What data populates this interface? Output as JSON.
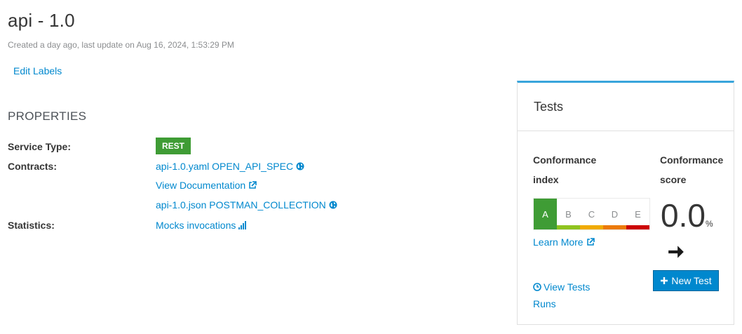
{
  "header": {
    "title": "api - 1.0",
    "subtitle": "Created a day ago, last update on Aug 16, 2024, 1:53:29 PM",
    "edit_labels": "Edit Labels"
  },
  "properties": {
    "heading": "PROPERTIES",
    "service_type_label": "Service Type:",
    "service_type_value": "REST",
    "contracts_label": "Contracts:",
    "contracts": [
      {
        "label": "api-1.0.yaml OPEN_API_SPEC",
        "icon": "globe-icon"
      },
      {
        "label": "View Documentation",
        "icon": "external-link-icon"
      },
      {
        "label": "api-1.0.json POSTMAN_COLLECTION",
        "icon": "globe-icon"
      }
    ],
    "statistics_label": "Statistics:",
    "statistics_link": "Mocks invocations",
    "statistics_icon": "bar-chart-icon"
  },
  "tests_card": {
    "title": "Tests",
    "conformance_index_title": "Conformance index",
    "conformance_score_title": "Conformance score",
    "grades": [
      {
        "label": "A",
        "color": "#3f9c35",
        "active": true
      },
      {
        "label": "B",
        "color": "#8fc31f",
        "active": false
      },
      {
        "label": "C",
        "color": "#f0ab00",
        "active": false
      },
      {
        "label": "D",
        "color": "#ec7a08",
        "active": false
      },
      {
        "label": "E",
        "color": "#cc0000",
        "active": false
      }
    ],
    "score_value": "0.0",
    "score_unit": "%",
    "learn_more": "Learn More",
    "new_test": "New Test",
    "view_tests_runs": "View Tests Runs"
  },
  "colors": {
    "link": "#0088ce",
    "accent": "#39a5dc",
    "rest_badge": "#3f9c35"
  }
}
